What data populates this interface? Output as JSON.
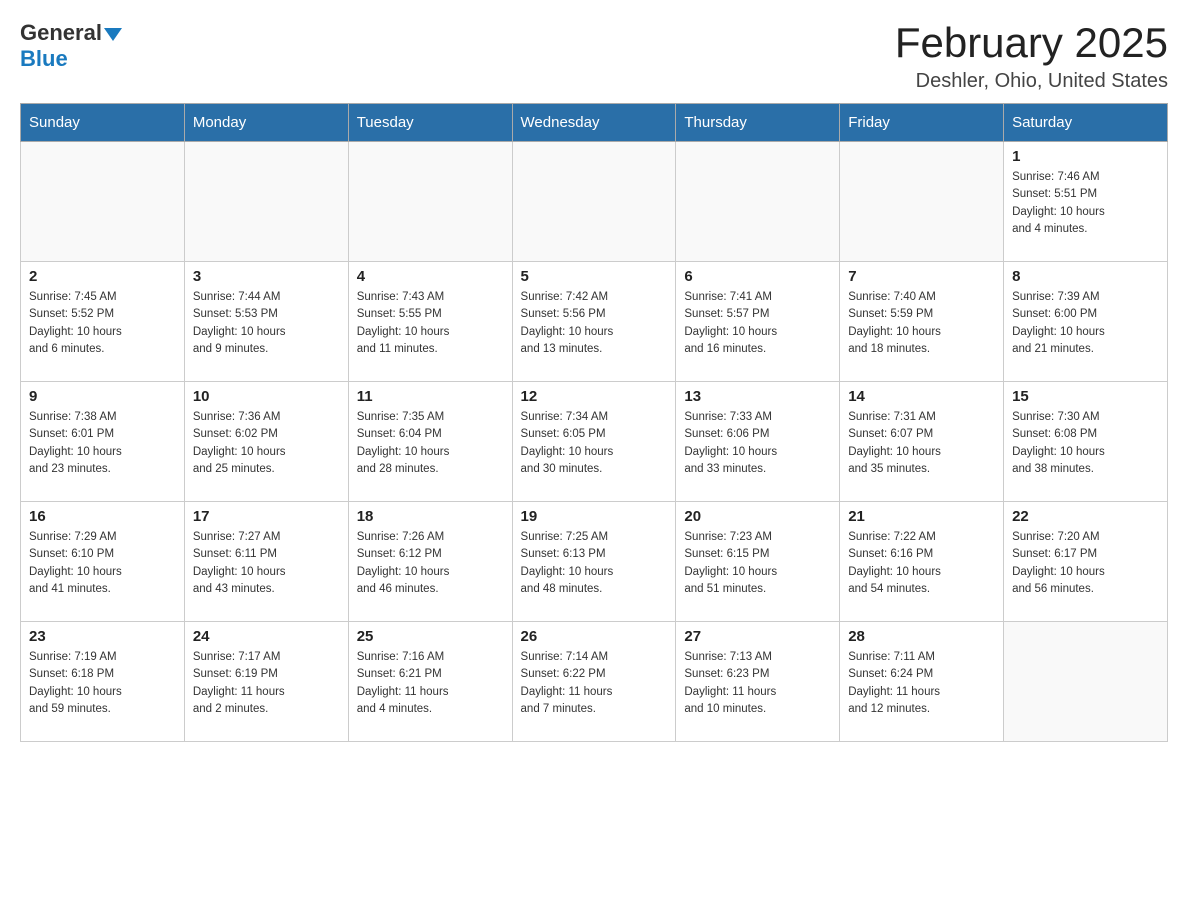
{
  "header": {
    "logo_general": "General",
    "logo_blue": "Blue",
    "month_title": "February 2025",
    "location": "Deshler, Ohio, United States"
  },
  "days_of_week": [
    "Sunday",
    "Monday",
    "Tuesday",
    "Wednesday",
    "Thursday",
    "Friday",
    "Saturday"
  ],
  "weeks": [
    {
      "days": [
        {
          "number": "",
          "info": ""
        },
        {
          "number": "",
          "info": ""
        },
        {
          "number": "",
          "info": ""
        },
        {
          "number": "",
          "info": ""
        },
        {
          "number": "",
          "info": ""
        },
        {
          "number": "",
          "info": ""
        },
        {
          "number": "1",
          "info": "Sunrise: 7:46 AM\nSunset: 5:51 PM\nDaylight: 10 hours\nand 4 minutes."
        }
      ]
    },
    {
      "days": [
        {
          "number": "2",
          "info": "Sunrise: 7:45 AM\nSunset: 5:52 PM\nDaylight: 10 hours\nand 6 minutes."
        },
        {
          "number": "3",
          "info": "Sunrise: 7:44 AM\nSunset: 5:53 PM\nDaylight: 10 hours\nand 9 minutes."
        },
        {
          "number": "4",
          "info": "Sunrise: 7:43 AM\nSunset: 5:55 PM\nDaylight: 10 hours\nand 11 minutes."
        },
        {
          "number": "5",
          "info": "Sunrise: 7:42 AM\nSunset: 5:56 PM\nDaylight: 10 hours\nand 13 minutes."
        },
        {
          "number": "6",
          "info": "Sunrise: 7:41 AM\nSunset: 5:57 PM\nDaylight: 10 hours\nand 16 minutes."
        },
        {
          "number": "7",
          "info": "Sunrise: 7:40 AM\nSunset: 5:59 PM\nDaylight: 10 hours\nand 18 minutes."
        },
        {
          "number": "8",
          "info": "Sunrise: 7:39 AM\nSunset: 6:00 PM\nDaylight: 10 hours\nand 21 minutes."
        }
      ]
    },
    {
      "days": [
        {
          "number": "9",
          "info": "Sunrise: 7:38 AM\nSunset: 6:01 PM\nDaylight: 10 hours\nand 23 minutes."
        },
        {
          "number": "10",
          "info": "Sunrise: 7:36 AM\nSunset: 6:02 PM\nDaylight: 10 hours\nand 25 minutes."
        },
        {
          "number": "11",
          "info": "Sunrise: 7:35 AM\nSunset: 6:04 PM\nDaylight: 10 hours\nand 28 minutes."
        },
        {
          "number": "12",
          "info": "Sunrise: 7:34 AM\nSunset: 6:05 PM\nDaylight: 10 hours\nand 30 minutes."
        },
        {
          "number": "13",
          "info": "Sunrise: 7:33 AM\nSunset: 6:06 PM\nDaylight: 10 hours\nand 33 minutes."
        },
        {
          "number": "14",
          "info": "Sunrise: 7:31 AM\nSunset: 6:07 PM\nDaylight: 10 hours\nand 35 minutes."
        },
        {
          "number": "15",
          "info": "Sunrise: 7:30 AM\nSunset: 6:08 PM\nDaylight: 10 hours\nand 38 minutes."
        }
      ]
    },
    {
      "days": [
        {
          "number": "16",
          "info": "Sunrise: 7:29 AM\nSunset: 6:10 PM\nDaylight: 10 hours\nand 41 minutes."
        },
        {
          "number": "17",
          "info": "Sunrise: 7:27 AM\nSunset: 6:11 PM\nDaylight: 10 hours\nand 43 minutes."
        },
        {
          "number": "18",
          "info": "Sunrise: 7:26 AM\nSunset: 6:12 PM\nDaylight: 10 hours\nand 46 minutes."
        },
        {
          "number": "19",
          "info": "Sunrise: 7:25 AM\nSunset: 6:13 PM\nDaylight: 10 hours\nand 48 minutes."
        },
        {
          "number": "20",
          "info": "Sunrise: 7:23 AM\nSunset: 6:15 PM\nDaylight: 10 hours\nand 51 minutes."
        },
        {
          "number": "21",
          "info": "Sunrise: 7:22 AM\nSunset: 6:16 PM\nDaylight: 10 hours\nand 54 minutes."
        },
        {
          "number": "22",
          "info": "Sunrise: 7:20 AM\nSunset: 6:17 PM\nDaylight: 10 hours\nand 56 minutes."
        }
      ]
    },
    {
      "days": [
        {
          "number": "23",
          "info": "Sunrise: 7:19 AM\nSunset: 6:18 PM\nDaylight: 10 hours\nand 59 minutes."
        },
        {
          "number": "24",
          "info": "Sunrise: 7:17 AM\nSunset: 6:19 PM\nDaylight: 11 hours\nand 2 minutes."
        },
        {
          "number": "25",
          "info": "Sunrise: 7:16 AM\nSunset: 6:21 PM\nDaylight: 11 hours\nand 4 minutes."
        },
        {
          "number": "26",
          "info": "Sunrise: 7:14 AM\nSunset: 6:22 PM\nDaylight: 11 hours\nand 7 minutes."
        },
        {
          "number": "27",
          "info": "Sunrise: 7:13 AM\nSunset: 6:23 PM\nDaylight: 11 hours\nand 10 minutes."
        },
        {
          "number": "28",
          "info": "Sunrise: 7:11 AM\nSunset: 6:24 PM\nDaylight: 11 hours\nand 12 minutes."
        },
        {
          "number": "",
          "info": ""
        }
      ]
    }
  ]
}
